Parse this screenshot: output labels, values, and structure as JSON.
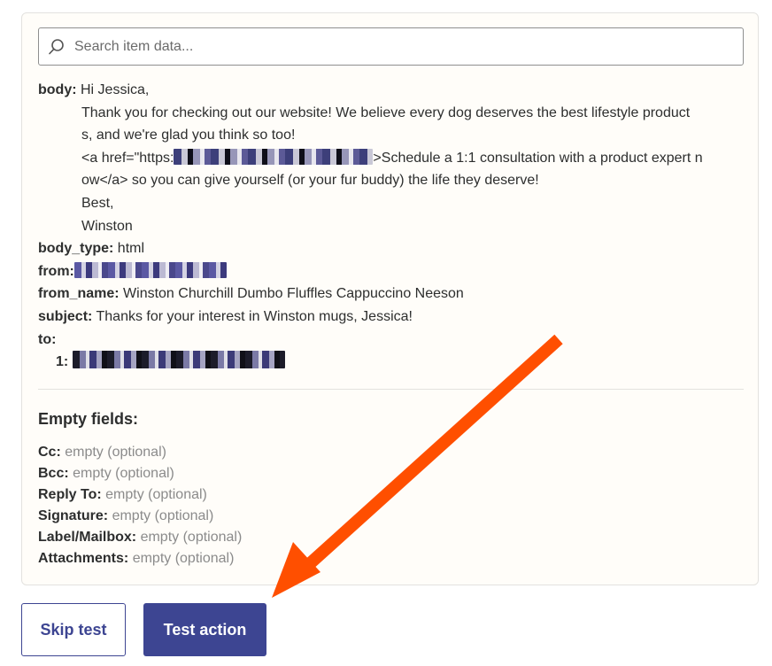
{
  "search": {
    "placeholder": "Search item data..."
  },
  "fields": {
    "body_key": "body:",
    "body_lines": [
      "Hi Jessica,",
      "Thank you for checking out our website! We believe every dog deserves the best lifestyle product",
      "s, and we're glad you think so too!",
      "<a href=\"https:",
      ">Schedule a 1:1 consultation with a product expert n",
      "ow</a> so you can give yourself (or your fur buddy) the life they deserve!",
      "Best,",
      "Winston"
    ],
    "body_type_key": "body_type:",
    "body_type_value": "html",
    "from_key": "from:",
    "from_name_key": "from_name:",
    "from_name_value": "Winston Churchill Dumbo Fluffles Cappuccino Neeson",
    "subject_key": "subject:",
    "subject_value": "Thanks for your interest in Winston mugs, Jessica!",
    "to_key": "to:",
    "to_item_key": "1:"
  },
  "empty": {
    "title": "Empty fields:",
    "items": [
      {
        "label": "Cc:",
        "value": "empty (optional)"
      },
      {
        "label": "Bcc:",
        "value": "empty (optional)"
      },
      {
        "label": "Reply To:",
        "value": "empty (optional)"
      },
      {
        "label": "Signature:",
        "value": "empty (optional)"
      },
      {
        "label": "Label/Mailbox:",
        "value": "empty (optional)"
      },
      {
        "label": "Attachments:",
        "value": "empty (optional)"
      }
    ]
  },
  "buttons": {
    "skip": "Skip test",
    "test": "Test action"
  },
  "colors": {
    "accent": "#3d4592",
    "arrow": "#ff4f00",
    "panel_bg": "#fffdf9"
  },
  "icons": {
    "search": "search-icon",
    "annotation": "arrow-annotation"
  }
}
